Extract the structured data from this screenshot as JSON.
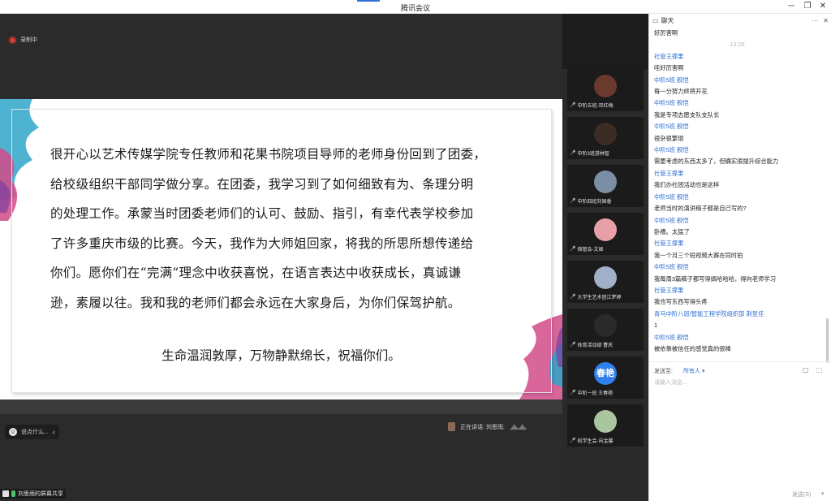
{
  "window": {
    "title": "腾讯会议",
    "minimize": "─",
    "restore": "❐",
    "close": "✕",
    "accent_color": "#2f6fd8"
  },
  "recording": {
    "label": "录制中"
  },
  "slide": {
    "lines": [
      "很开心以艺术传媒学院专任教师和花果书院项目导师的老师身份回到了团委，",
      "给校级组织干部同学做分享。在团委，我学习到了如何细致有为、条理分明",
      "的处理工作。承蒙当时团委老师们的认可、鼓励、指引，有幸代表学校参加",
      "了许多重庆市级的比赛。今天，我作为大师姐回家，将我的所思所想传递给",
      "你们。愿你们在“完满”理念中收获喜悦，在语言表达中收获成长，真诚谦",
      "逊，素履以往。我和我的老师们都会永远在大家身后，为你们保驾护航。"
    ],
    "closing": "生命温润敦厚，万物静默绵长，祝福你们。"
  },
  "speak_input": {
    "placeholder": "说点什么...",
    "icon": "☺",
    "collapse": "‹"
  },
  "speaking": {
    "label": "正在讲话: 刘思雨;"
  },
  "screen_share": {
    "label": "刘思雨的屏幕共享"
  },
  "participants": [
    {
      "name": "中阶五班-邓红梅",
      "avatar_color": "#6b3a2e",
      "avatar_text": ""
    },
    {
      "name": "中阶3班游林智",
      "avatar_color": "#3b2c24",
      "avatar_text": ""
    },
    {
      "name": "中阶四班刘国香",
      "avatar_color": "#7a8fa6",
      "avatar_text": ""
    },
    {
      "name": "宿管会-文娅",
      "avatar_color": "#e8a0a8",
      "avatar_text": ""
    },
    {
      "name": "大学生艺术团江梦婷",
      "avatar_color": "#9fb0c8",
      "avatar_text": ""
    },
    {
      "name": "体育活动部 曹庆",
      "avatar_color": "#2a2a2a",
      "avatar_text": ""
    },
    {
      "name": "中阶一班 王春艳",
      "avatar_color": "#2f80ed",
      "avatar_text": "春艳"
    },
    {
      "name": "校学生会-向金馨",
      "avatar_color": "#a9c6a0",
      "avatar_text": ""
    }
  ],
  "chat": {
    "title": "聊天",
    "more": "···",
    "close": "✕",
    "entries": [
      {
        "kind": "text",
        "value": "好厉害啊"
      },
      {
        "kind": "time",
        "value": "13:26"
      },
      {
        "kind": "author",
        "value": "社管王撑果"
      },
      {
        "kind": "text",
        "value": "哇好厉害啊"
      },
      {
        "kind": "author",
        "value": "中阶5班 舰恺"
      },
      {
        "kind": "text",
        "value": "每一分努力终将开花"
      },
      {
        "kind": "author",
        "value": "中阶5班 舰恺"
      },
      {
        "kind": "text",
        "value": "我是专项志愿支队支队长"
      },
      {
        "kind": "author",
        "value": "中阶5班 舰恺"
      },
      {
        "kind": "text",
        "value": "很杂很繁琐"
      },
      {
        "kind": "author",
        "value": "中阶5班 舰恺"
      },
      {
        "kind": "text",
        "value": "需要考虑的东西太多了，但确实很提升综合能力"
      },
      {
        "kind": "author",
        "value": "社管王撑果"
      },
      {
        "kind": "text",
        "value": "我们办社团活动也是这样"
      },
      {
        "kind": "author",
        "value": "中阶5班 舰恺"
      },
      {
        "kind": "text",
        "value": "老师当时的演讲稿子都是自己写的?"
      },
      {
        "kind": "author",
        "value": "中阶5班 舰恺"
      },
      {
        "kind": "text",
        "value": "卧槽。太猛了"
      },
      {
        "kind": "author",
        "value": "社管王撑果"
      },
      {
        "kind": "text",
        "value": "我一个月三个短视频大赛在同时拍"
      },
      {
        "kind": "author",
        "value": "中阶5班 舰恺"
      },
      {
        "kind": "text",
        "value": "我每周3篇稿子都写得嫣哈哈哈，得向老师学习"
      },
      {
        "kind": "author",
        "value": "社管王撑果"
      },
      {
        "kind": "text",
        "value": "我也写东西写得头疼"
      },
      {
        "kind": "author",
        "value": "青马中阶八班/智能工程学院组织部 荆昱佳"
      },
      {
        "kind": "text",
        "value": "1"
      },
      {
        "kind": "author",
        "value": "中阶5班 舰恺"
      },
      {
        "kind": "text",
        "value": "被依靠被信任的感觉真的很棒"
      }
    ],
    "send_to_label": "发送至:",
    "send_to_value": "所有人 ▾",
    "input_placeholder": "请输入消息...",
    "send_label": "发送(S)",
    "send_caret": "▾"
  }
}
